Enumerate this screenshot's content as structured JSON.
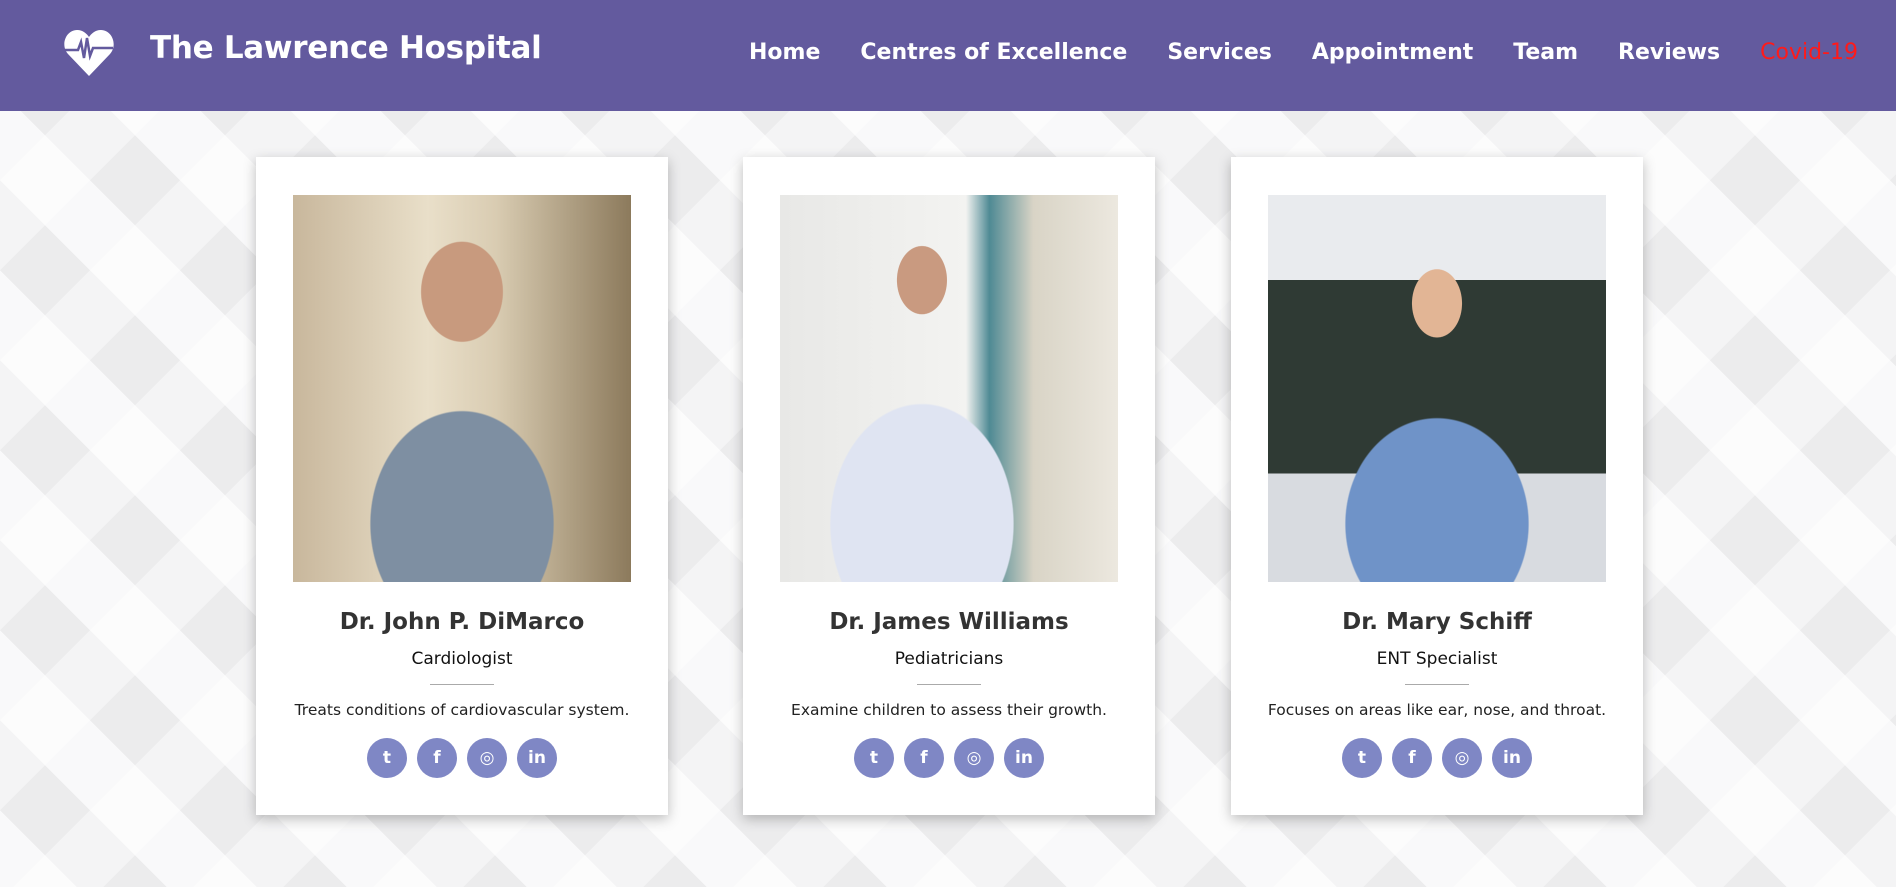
{
  "header": {
    "title": "The Lawrence Hospital",
    "accent": "#635a9e",
    "nav": [
      "Home",
      "Centres of Excellence",
      "Services",
      "Appointment",
      "Team",
      "Reviews",
      "Covid-19"
    ]
  },
  "social_icons": [
    "twitter-icon",
    "facebook-icon",
    "instagram-icon",
    "linkedin-icon"
  ],
  "social_color": "#7f87c5",
  "doctors": [
    {
      "name": "Dr. John P. DiMarco",
      "specialty": "Cardiologist",
      "description": "Treats conditions of cardiovascular system."
    },
    {
      "name": "Dr. James Williams",
      "specialty": "Pediatricians",
      "description": "Examine children to assess their growth."
    },
    {
      "name": "Dr. Mary Schiff",
      "specialty": "ENT Specialist",
      "description": "Focuses on areas like ear, nose, and throat."
    }
  ]
}
